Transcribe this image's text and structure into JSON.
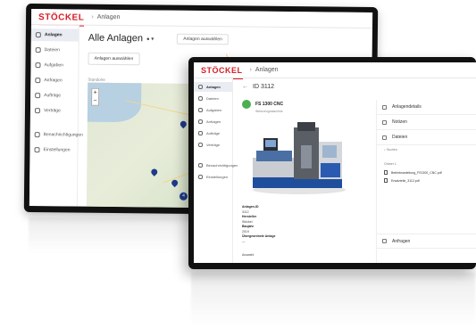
{
  "brand": "STÖCKEL",
  "back_window": {
    "breadcrumb": "Anlagen",
    "sidebar": [
      "Anlagen",
      "Dateien",
      "Aufgaben",
      "Anfragen",
      "Aufträge",
      "Verträge",
      "Benachrichtigungen",
      "Einstellungen"
    ],
    "page_title": "Alle Anlagen",
    "filter": "Anlagen auswählen",
    "button": "Anlagen auswählen",
    "map_label": "Standorte",
    "cluster_count": "4"
  },
  "front_window": {
    "breadcrumb": "Anlagen",
    "sidebar": [
      "Anlagen",
      "Dateien",
      "Aufgaben",
      "Anfragen",
      "Aufträge",
      "Verträge",
      "Benachrichtigungen",
      "Einstellungen"
    ],
    "record_title": "ID 3112",
    "machine_name": "FS 1300 CNC",
    "machine_sub": "Werkzeugmaschine",
    "details": [
      {
        "k": "Anlagen-ID",
        "v": "3112"
      },
      {
        "k": "Hersteller",
        "v": "Stöckel"
      },
      {
        "k": "Baujahr",
        "v": "2019"
      },
      {
        "k": "Übergeordnete Anlage",
        "v": "—"
      }
    ],
    "extra_label": "Auswahl",
    "right_rows": [
      "Anlagendetails",
      "Notizen",
      "Dateien"
    ],
    "file_search": "Suchen",
    "files_count": "Ordner 1",
    "documents": [
      "Betriebsanleitung_FS1300_CNC.pdf",
      "Ersatzteile_3112.pdf"
    ],
    "bottom_row": "Anfragen"
  }
}
